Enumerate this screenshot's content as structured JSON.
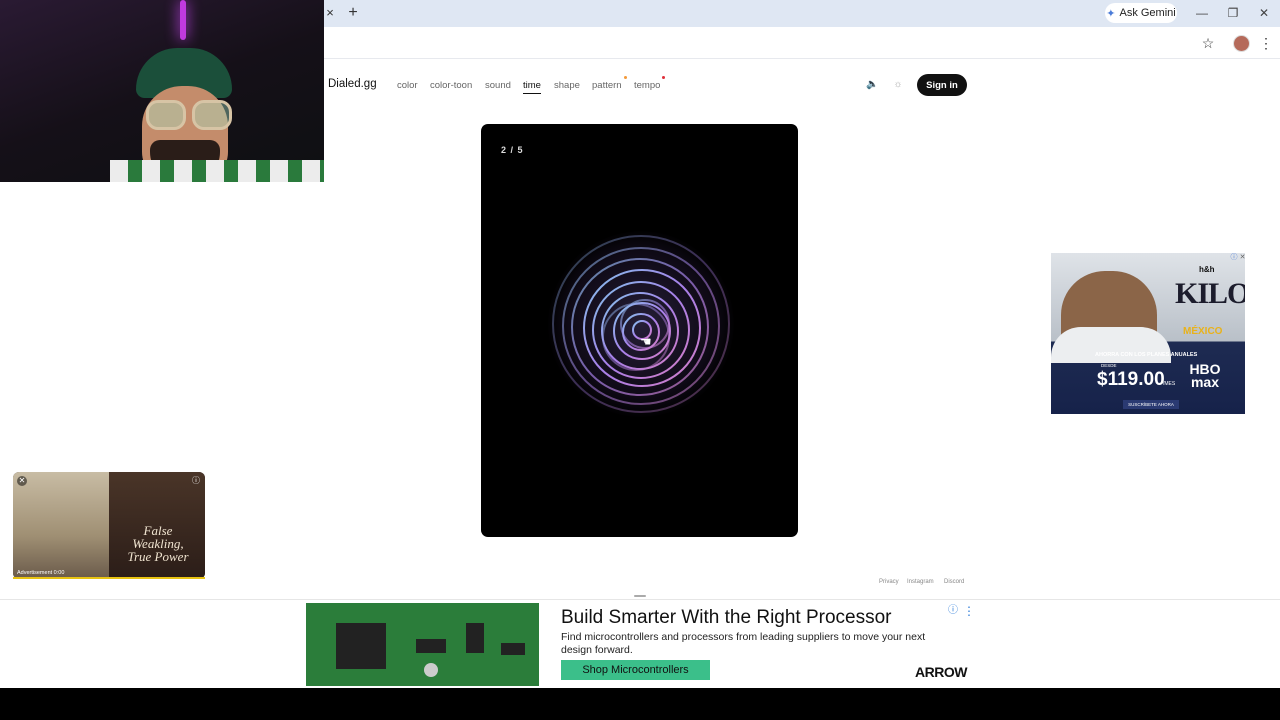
{
  "browser": {
    "tab_close": "×",
    "new_tab": "+",
    "ask_gemini": "Ask Gemini",
    "minimize": "—",
    "restore": "❐",
    "close": "✕",
    "bookmark_icon": "☆",
    "menu_icon": "⋮"
  },
  "site": {
    "logo": "Dialed.gg",
    "nav": [
      "color",
      "color-toon",
      "sound",
      "time",
      "shape",
      "pattern",
      "tempo"
    ],
    "active_nav": "time",
    "sign_in": "Sign in"
  },
  "game": {
    "counter": "2 / 5"
  },
  "footer": {
    "links": [
      "Privacy",
      "Instagram",
      "Discord"
    ]
  },
  "side_ad": {
    "brand": "h&h",
    "headline": "KILOS",
    "subhead": "MÉXICO",
    "desc": "AHORRA CON LOS PLANES ANUALES",
    "from": "DESDE",
    "price": "$119.00",
    "per": "/MES",
    "hbo": "HBO max",
    "cta": "SUSCRÍBETE AHORA"
  },
  "mini_ad": {
    "title": "False Weakling, True Power",
    "label": "Advertisement 0:00"
  },
  "banner": {
    "title": "Build Smarter With the Right Processor",
    "desc": "Find microcontrollers and processors from leading suppliers to move your next design forward.",
    "cta": "Shop Microcontrollers",
    "brand": "ARROW"
  },
  "colors": {
    "accent_dot_orange": "#f39a3a",
    "accent_dot_red": "#e0303a",
    "banner_cta": "#3bbf8a"
  }
}
